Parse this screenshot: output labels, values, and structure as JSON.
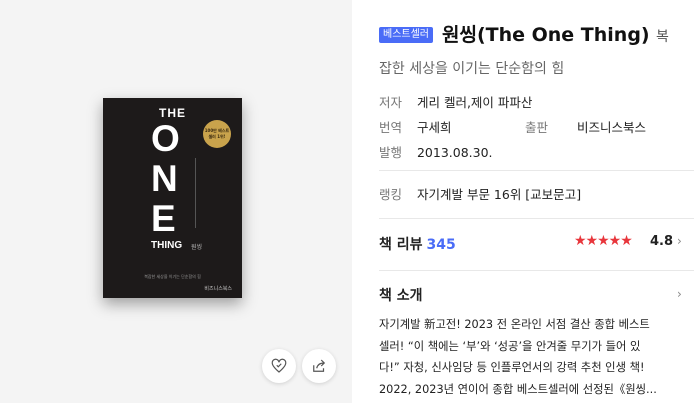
{
  "cover": {
    "the": "THE",
    "o": "O",
    "n": "N",
    "e": "E",
    "thing": "THING",
    "thing_kr": "원씽",
    "seal_text": "100만 베스트셀러 1위!",
    "tagline": "복잡한 세상을 이기는 단순함의 힘",
    "publisher_mark": "비즈니스북스"
  },
  "actions": {
    "like_icon": "heart-icon",
    "share_icon": "share-icon"
  },
  "book": {
    "badge": "베스트셀러",
    "title": "원씽(The One Thing)",
    "title_tail": "복",
    "subtitle": "잡한 세상을 이기는 단순함의 힘",
    "author_label": "저자",
    "author": "게리 켈러,제이 파파산",
    "translator_label": "번역",
    "translator": "구세희",
    "publisher_label": "출판",
    "publisher": "비즈니스북스",
    "date_label": "발행",
    "date": "2013.08.30.",
    "rank_label": "랭킹",
    "rank": "자기계발 부문 16위 [교보문고]"
  },
  "review": {
    "label": "책 리뷰",
    "count": "345",
    "stars": "★★★★★",
    "rating": "4.8",
    "chevron": "›"
  },
  "intro": {
    "label": "책 소개",
    "chevron": "›",
    "lines": [
      "자기계발 新고전! 2023 전 온라인 서점 결산 종합 베스트",
      "셀러! “이 책에는 ‘부’와 ‘성공’을 안겨줄 무기가 들어 있",
      "다!” 자청, 신사임당 등 인플루언서의 강력 추천 인생 책!",
      "2022, 2023년 연이어 종합 베스트셀러에 선정된《원씽..."
    ]
  }
}
